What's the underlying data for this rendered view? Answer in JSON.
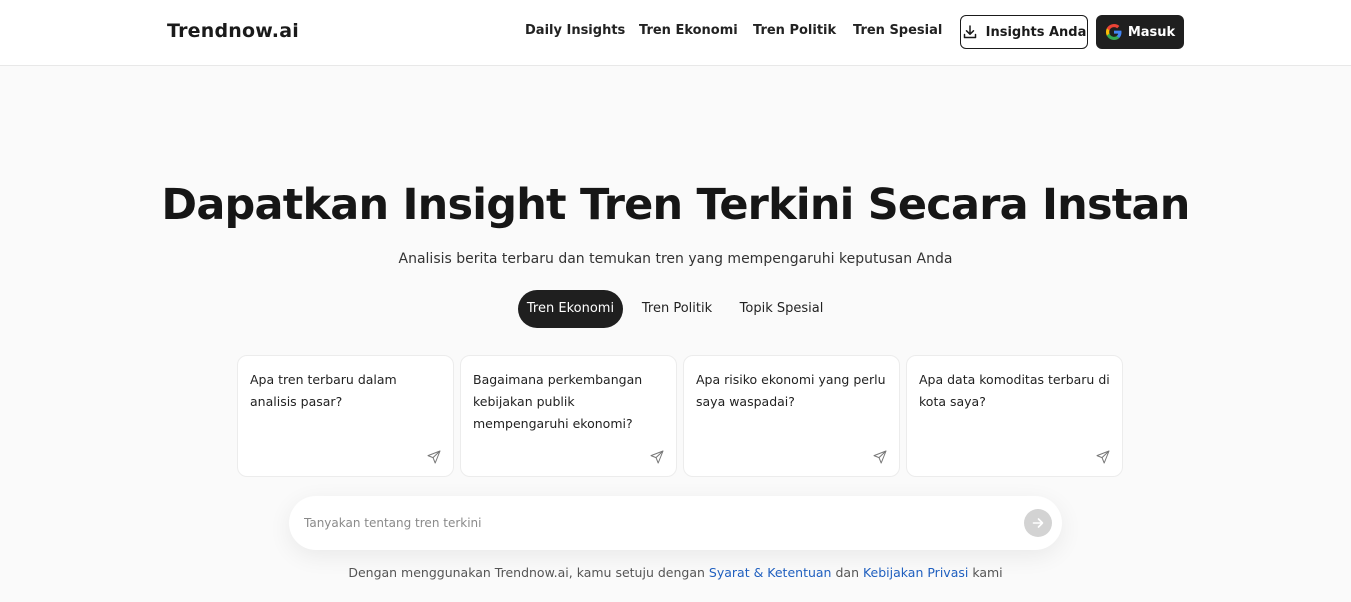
{
  "header": {
    "logo": "Trendnow.ai",
    "nav": [
      "Daily Insights",
      "Tren Ekonomi",
      "Tren Politik",
      "Tren Spesial"
    ],
    "insights_button": "Insights Anda",
    "login_button": "Masuk"
  },
  "hero": {
    "title": "Dapatkan Insight Tren Terkini Secara Instan",
    "subtitle": "Analisis berita terbaru dan temukan tren yang mempengaruhi keputusan Anda"
  },
  "tabs": [
    {
      "label": "Tren Ekonomi",
      "active": true
    },
    {
      "label": "Tren Politik",
      "active": false
    },
    {
      "label": "Topik Spesial",
      "active": false
    }
  ],
  "cards": [
    {
      "text": "Apa tren terbaru dalam analisis pasar?"
    },
    {
      "text": "Bagaimana perkembangan kebijakan publik mempengaruhi ekonomi?"
    },
    {
      "text": "Apa risiko ekonomi yang perlu saya waspadai?"
    },
    {
      "text": "Apa data komoditas terbaru di kota saya?"
    }
  ],
  "search": {
    "placeholder": "Tanyakan tentang tren terkini",
    "value": ""
  },
  "footer": {
    "prefix": "Dengan menggunakan Trendnow.ai, kamu setuju dengan",
    "terms_link": "Syarat & Ketentuan",
    "conjunction": "dan",
    "privacy_link": "Kebijakan Privasi",
    "suffix": "kami"
  },
  "colors": {
    "background": "#fafafa",
    "dark_button": "#1f1f1f",
    "link": "#1f5fbf",
    "send_button": "#d3d3d3"
  },
  "icons": {
    "insights_button": "download-icon",
    "login_button": "google-icon",
    "cards": "send-icon",
    "search": "arrow-right-icon"
  }
}
